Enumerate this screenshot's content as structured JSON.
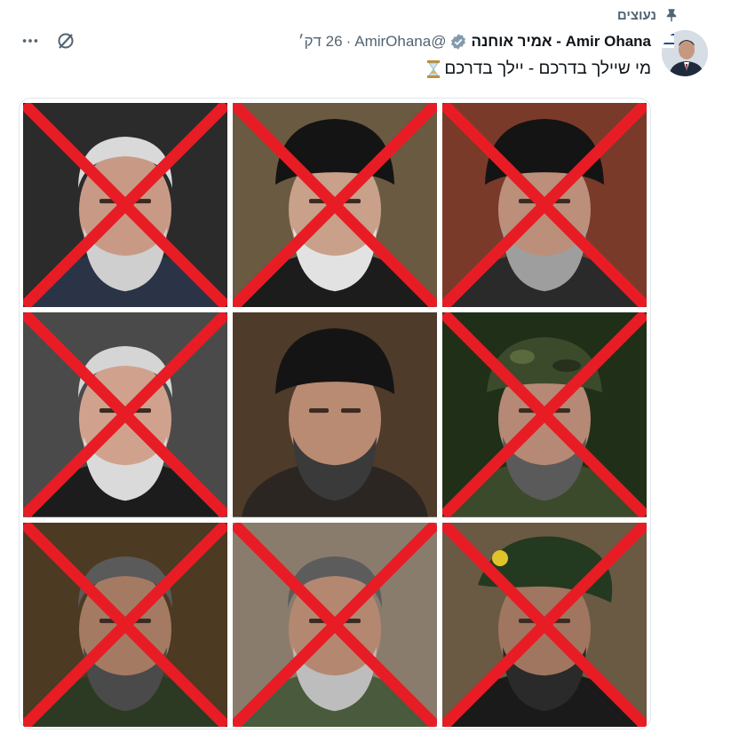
{
  "pinned": {
    "label": "נעוצים",
    "icon": "pin-icon"
  },
  "author": {
    "display_name": "Amir Ohana - אמיר אוחנה",
    "handle": "@AmirOhana",
    "separator": "·",
    "time": "26 דק׳",
    "verified_color": "#829aab",
    "avatar_icon": "avatar"
  },
  "tweet": {
    "text": "מי שיילך בדרכם - יילך בדרכם",
    "emoji_icon": "hourglass-icon"
  },
  "actions": {
    "grok_icon": "grok-icon",
    "more_icon": "more-icon"
  },
  "colors": {
    "accent_red": "#e81c24",
    "link_gray": "#536471"
  },
  "media": {
    "photos": [
      {
        "name": "photo-1",
        "crossed": true,
        "bg": "#2b2b2b",
        "skin": "#c89a86",
        "hair": "#d9d9d9",
        "hat": "none",
        "beard": "#cfcfcf",
        "clothes": "#2a3446"
      },
      {
        "name": "photo-2",
        "crossed": true,
        "bg": "#6b5a42",
        "skin": "#c9a08a",
        "hair": "#cfcfcf",
        "hat": "turban",
        "beard": "#e2e2e2",
        "clothes": "#1c1c1c"
      },
      {
        "name": "photo-3",
        "crossed": true,
        "bg": "#7a3a2a",
        "skin": "#bb8f7a",
        "hair": "#8a8a8a",
        "hat": "turban",
        "beard": "#9e9e9e",
        "clothes": "#2a2a2a"
      },
      {
        "name": "photo-4",
        "crossed": true,
        "bg": "#4a4a4a",
        "skin": "#d0a28e",
        "hair": "#d5d5d5",
        "hat": "none",
        "beard": "#dadada",
        "clothes": "#1c1c1c"
      },
      {
        "name": "photo-5",
        "crossed": false,
        "bg": "#4e3b2a",
        "skin": "#b88b72",
        "hair": "#333333",
        "hat": "turban",
        "beard": "#3a3a3a",
        "clothes": "#2b2622"
      },
      {
        "name": "photo-6",
        "crossed": true,
        "bg": "#203018",
        "skin": "#b58975",
        "hair": "#333333",
        "hat": "camo",
        "beard": "#5a5a5a",
        "clothes": "#3b4a2a"
      },
      {
        "name": "photo-7",
        "crossed": true,
        "bg": "#4c3a22",
        "skin": "#a57a62",
        "hair": "#5a5a5a",
        "hat": "none",
        "beard": "#4a4a4a",
        "clothes": "#2c3a24"
      },
      {
        "name": "photo-8",
        "crossed": true,
        "bg": "#8a7c6c",
        "skin": "#b48870",
        "hair": "#5c5c5c",
        "hat": "none",
        "beard": "#bdbdbd",
        "clothes": "#4a5a3c"
      },
      {
        "name": "photo-9",
        "crossed": true,
        "bg": "#6a5a44",
        "skin": "#a07660",
        "hair": "#333333",
        "hat": "beret",
        "beard": "#2a2a2a",
        "clothes": "#1a1a1a"
      }
    ]
  }
}
